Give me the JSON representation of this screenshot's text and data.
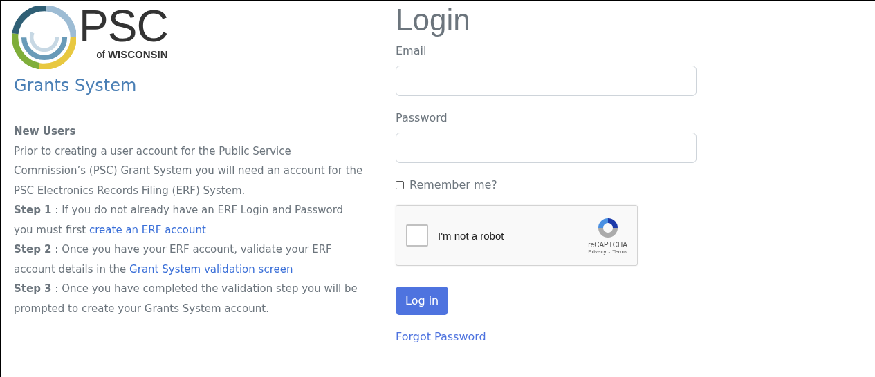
{
  "logo": {
    "title": "PSC",
    "subtitle": "of **WISCONSIN**"
  },
  "app_title": "Grants System",
  "new_users": {
    "heading": "New Users",
    "intro": "Prior to creating a user account for the Public Service Commission’s (PSC) Grant System you will need an account for the PSC Electronics Records Filing (ERF) System.",
    "steps": [
      {
        "text": "**Step 1** : If you do not already have an ERF Login and Password you must first ",
        "link": "create an ERF account"
      },
      {
        "text": "**Step 2** : Once you have your ERF account, validate your ERF account details in the ",
        "link": "Grant System validation screen"
      },
      {
        "text": "**Step 3** : Once you have completed the validation step you will be prompted to create your Grants System account."
      }
    ]
  },
  "login": {
    "heading": "Login",
    "fields": [
      {
        "label": "Email"
      },
      {
        "label": "Password"
      }
    ],
    "remember": {
      "label": "Remember me?",
      "checked": false
    },
    "captcha": {
      "label": "I'm not a robot",
      "checked": false,
      "brand": "reCAPTCHA",
      "privacy": "Privacy",
      "separator": "-",
      "terms": "Terms"
    },
    "submit": "Log in",
    "forgot": "Forgot Password"
  }
}
